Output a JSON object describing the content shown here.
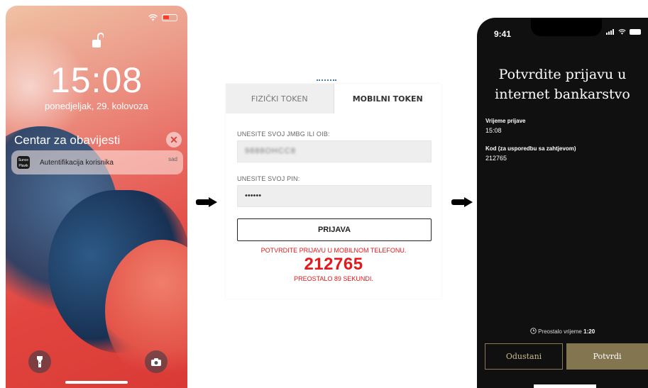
{
  "lock_screen": {
    "time": "15:08",
    "date": "ponedjeljak, 29. kolovoza",
    "notification_center_title": "Centar za obavijesti",
    "notification": {
      "app_icon": "bank-app-icon",
      "app_icon_text": "Sunce Plavik",
      "text": "Autentifikacija korisnika",
      "when": "sad"
    },
    "icons": [
      "wifi-icon",
      "battery-icon",
      "unlock-icon",
      "flashlight-icon",
      "camera-icon",
      "close-icon"
    ]
  },
  "web_login": {
    "tabs": [
      {
        "label": "FIZIČKI TOKEN",
        "active": false
      },
      {
        "label": "MOBILNI TOKEN",
        "active": true
      }
    ],
    "id_label": "UNESITE SVOJ JMBG ILI OIB:",
    "id_value": "9888OHCC8",
    "pin_label": "UNESITE SVOJ PIN:",
    "pin_value": "••••••",
    "submit_label": "PRIJAVA",
    "confirm_message": "POTVRDITE PRIJAVU U MOBILNOM TELEFONU.",
    "code": "212765",
    "remaining": "PREOSTALO 89 SEKUNDI."
  },
  "phone_app": {
    "status_time": "9:41",
    "title_line1": "Potvrdite prijavu u",
    "title_line2": "internet bankarstvo",
    "login_time_label": "Vrijeme prijave",
    "login_time_value": "15:08",
    "code_label": "Kod (za usporedbu sa zahtjevom)",
    "code_value": "212765",
    "timer_label": "Preostalo vrijeme",
    "timer_value": "1:20",
    "cancel_label": "Odustani",
    "confirm_label": "Potvrdi"
  },
  "colors": {
    "red_accent": "#e3191b",
    "gold_button": "#83754f",
    "dark_bg": "#101010"
  }
}
